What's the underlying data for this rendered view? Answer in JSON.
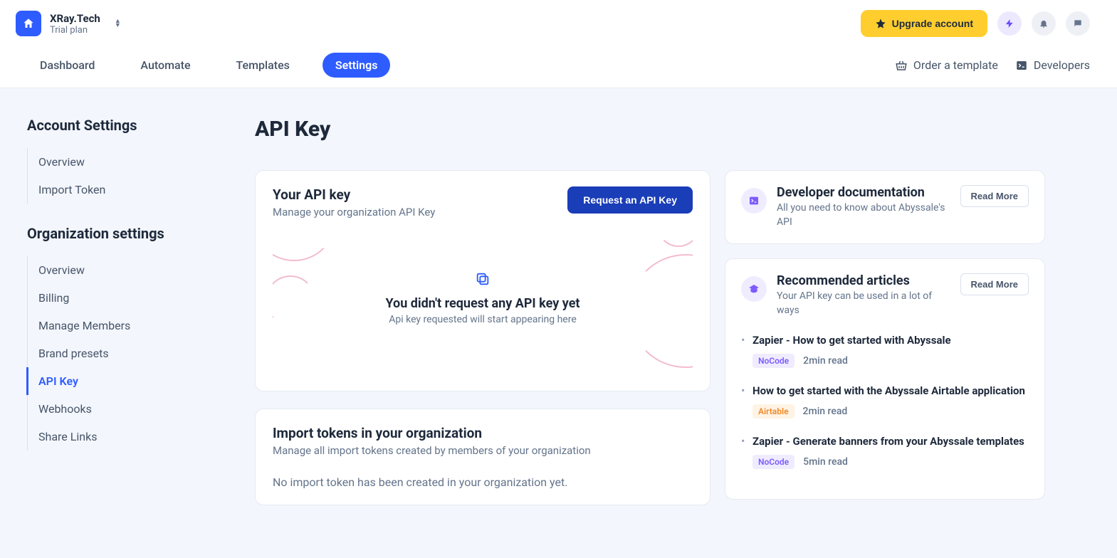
{
  "header": {
    "org_name": "XRay.Tech",
    "org_plan": "Trial plan",
    "upgrade_label": "Upgrade account"
  },
  "nav": {
    "items": [
      {
        "label": "Dashboard"
      },
      {
        "label": "Automate"
      },
      {
        "label": "Templates"
      },
      {
        "label": "Settings",
        "active": true
      }
    ],
    "order_template": "Order a template",
    "developers": "Developers"
  },
  "sidebar": {
    "account_heading": "Account Settings",
    "account_items": [
      {
        "label": "Overview"
      },
      {
        "label": "Import Token"
      }
    ],
    "org_heading": "Organization settings",
    "org_items": [
      {
        "label": "Overview"
      },
      {
        "label": "Billing"
      },
      {
        "label": "Manage Members"
      },
      {
        "label": "Brand presets"
      },
      {
        "label": "API Key",
        "active": true
      },
      {
        "label": "Webhooks"
      },
      {
        "label": "Share Links"
      }
    ]
  },
  "page": {
    "title": "API Key",
    "api_card": {
      "title": "Your API key",
      "subtitle": "Manage your organization API Key",
      "button": "Request an API Key",
      "empty_title": "You didn't request any API key yet",
      "empty_sub": "Api key requested will start appearing here"
    },
    "tokens_card": {
      "title": "Import tokens in your organization",
      "subtitle": "Manage all import tokens created by members of your organization",
      "empty": "No import token has been created in your organization yet."
    },
    "doc_card": {
      "title": "Developer documentation",
      "subtitle": "All you need to know about Abyssale's API",
      "button": "Read More"
    },
    "rec_card": {
      "title": "Recommended articles",
      "subtitle": "Your API key can be used in a lot of ways",
      "button": "Read More",
      "articles": [
        {
          "title": "Zapier - How to get started with Abyssale",
          "tag": "NoCode",
          "tag_class": "nocode",
          "readtime": "2min read"
        },
        {
          "title": "How to get started with the Abyssale Airtable application",
          "tag": "Airtable",
          "tag_class": "airtable",
          "readtime": "2min read"
        },
        {
          "title": "Zapier - Generate banners from your Abyssale templates",
          "tag": "NoCode",
          "tag_class": "nocode",
          "readtime": "5min read"
        }
      ]
    }
  }
}
